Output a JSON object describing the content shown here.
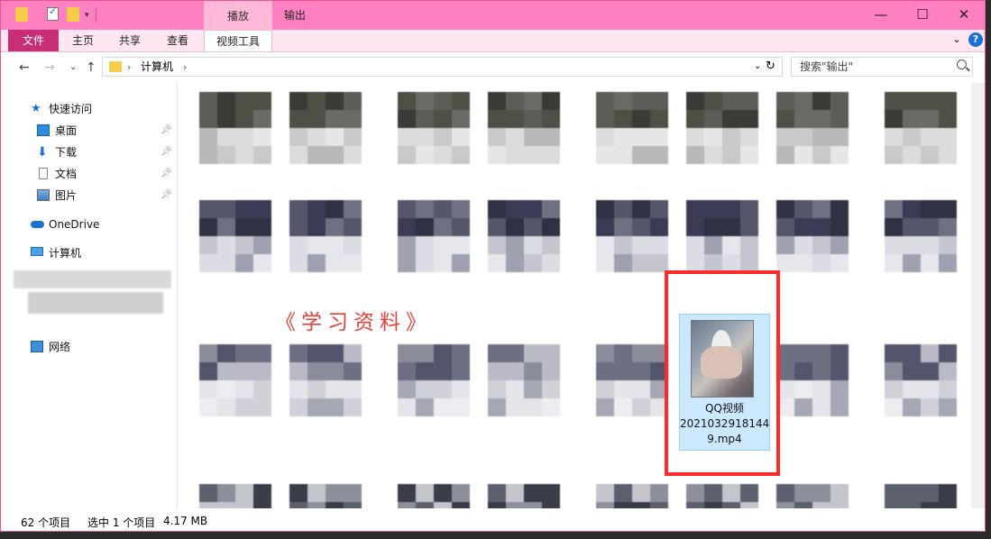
{
  "titlebar": {
    "contextual_tab": "播放",
    "title": "输出",
    "minimize_icon": "minimize-icon",
    "maximize_icon": "maximize-icon",
    "close_icon": "close-icon"
  },
  "ribbon": {
    "tabs": [
      {
        "label": "文件"
      },
      {
        "label": "主页"
      },
      {
        "label": "共享"
      },
      {
        "label": "查看"
      },
      {
        "label": "视频工具"
      }
    ],
    "help_label": "?"
  },
  "address": {
    "path": [
      "计算机"
    ],
    "search_placeholder": "搜索\"输出\""
  },
  "sidebar": {
    "quick_access": "快速访问",
    "items": [
      {
        "label": "桌面",
        "icon": "desktop-icon"
      },
      {
        "label": "下载",
        "icon": "download-icon"
      },
      {
        "label": "文档",
        "icon": "documents-icon"
      },
      {
        "label": "图片",
        "icon": "pictures-icon"
      }
    ],
    "onedrive": "OneDrive",
    "computer": "计算机",
    "network": "网络"
  },
  "content": {
    "overlay_text": "《学习资料》",
    "selected_file": {
      "line1": "QQ视频",
      "line2": "2021032918144",
      "line3": "9.mp4"
    }
  },
  "status": {
    "item_count": "62 个项目",
    "selection": "选中 1 个项目",
    "size": "4.17 MB"
  },
  "colors": {
    "titlebar": "#ff80c0",
    "file_tab": "#c72e75",
    "selection": "#cce8ff",
    "highlight_frame": "#ff2b2b",
    "overlay_text": "#e3413a"
  }
}
